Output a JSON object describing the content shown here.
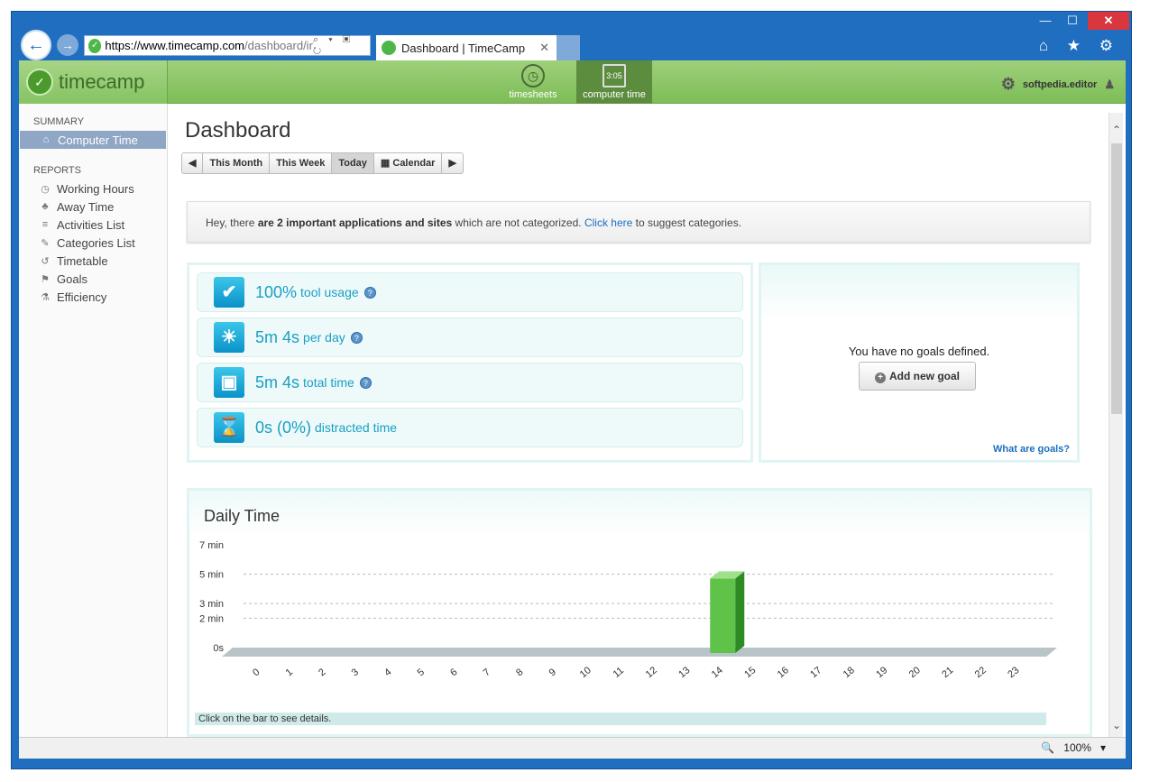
{
  "browser": {
    "url_host": "https://www.timecamp.com",
    "url_rest": "/dashboard/ir",
    "tab_title": "Dashboard | TimeCamp",
    "controls": {
      "min": "—",
      "max": "☐",
      "close": "✕"
    },
    "back_glyph": "←",
    "forward_glyph": "→",
    "addr_tools": "⌕ ▾ ▣ ↻",
    "tab_close": "✕",
    "right_tools": "⌂ ★ ⚙",
    "zoom": "100%",
    "zoom_glyph": "▾"
  },
  "app": {
    "logo_text": "timecamp",
    "nav": [
      {
        "label": "timesheets",
        "icon": "clock-icon"
      },
      {
        "label": "computer time",
        "icon": "bar-chart-icon",
        "badge": "3:05"
      }
    ],
    "user": "softpedia.editor"
  },
  "sidebar": {
    "summary_title": "SUMMARY",
    "summary_items": [
      {
        "label": "Computer Time",
        "icon": "home-icon",
        "glyph": "⌂"
      }
    ],
    "reports_title": "REPORTS",
    "reports_items": [
      {
        "label": "Working Hours",
        "icon": "clock-icon",
        "glyph": "◷"
      },
      {
        "label": "Away Time",
        "icon": "tree-icon",
        "glyph": "♣"
      },
      {
        "label": "Activities List",
        "icon": "list-icon",
        "glyph": "≡"
      },
      {
        "label": "Categories List",
        "icon": "edit-icon",
        "glyph": "✎"
      },
      {
        "label": "Timetable",
        "icon": "history-icon",
        "glyph": "↺"
      },
      {
        "label": "Goals",
        "icon": "flag-icon",
        "glyph": "⚑"
      },
      {
        "label": "Efficiency",
        "icon": "flask-icon",
        "glyph": "⚗"
      }
    ]
  },
  "main": {
    "title": "Dashboard",
    "range_buttons": {
      "prev": "◀",
      "month": "This Month",
      "week": "This Week",
      "today": "Today",
      "calendar": "Calendar",
      "next": "▶"
    },
    "notice": {
      "prefix": "Hey, there ",
      "bold": "are 2 important applications and sites",
      "middle": " which are not categorized. ",
      "link": "Click here",
      "suffix": " to suggest categories."
    },
    "stats": [
      {
        "value": "100%",
        "label": "tool usage",
        "icon": "check-icon",
        "glyph": "✔",
        "help": true
      },
      {
        "value": "5m 4s",
        "label": "per day",
        "icon": "sun-icon",
        "glyph": "☀",
        "help": true
      },
      {
        "value": "5m 4s",
        "label": "total time",
        "icon": "computer-icon",
        "glyph": "▣",
        "help": true
      },
      {
        "value": "0s (0%)",
        "label": "distracted time",
        "icon": "hourglass-icon",
        "glyph": "⌛",
        "help": false
      }
    ],
    "help_glyph": "?",
    "goals": {
      "empty_text": "You have no goals defined.",
      "add_button": "Add new goal",
      "add_glyph": "+",
      "help_link": "What are goals?"
    },
    "daily": {
      "title": "Daily Time",
      "hint": "Click on the bar to see details."
    }
  },
  "chart_data": {
    "type": "bar",
    "title": "Daily Time",
    "categories": [
      "0",
      "1",
      "2",
      "3",
      "4",
      "5",
      "6",
      "7",
      "8",
      "9",
      "10",
      "11",
      "12",
      "13",
      "14",
      "15",
      "16",
      "17",
      "18",
      "19",
      "20",
      "21",
      "22",
      "23"
    ],
    "values": [
      0,
      0,
      0,
      0,
      0,
      0,
      0,
      0,
      0,
      0,
      0,
      0,
      0,
      0,
      5.07,
      0,
      0,
      0,
      0,
      0,
      0,
      0,
      0,
      0
    ],
    "y_ticks": [
      {
        "value": 0,
        "label": "0s"
      },
      {
        "value": 2,
        "label": "2 min"
      },
      {
        "value": 3,
        "label": "3 min"
      },
      {
        "value": 5,
        "label": "5 min"
      },
      {
        "value": 7,
        "label": "7 min"
      }
    ],
    "ylim": [
      0,
      7
    ],
    "grid": true,
    "colors": {
      "bar": "#5fc34a",
      "bar_dark": "#2e8a22",
      "floor": "#b8c4c8"
    }
  }
}
